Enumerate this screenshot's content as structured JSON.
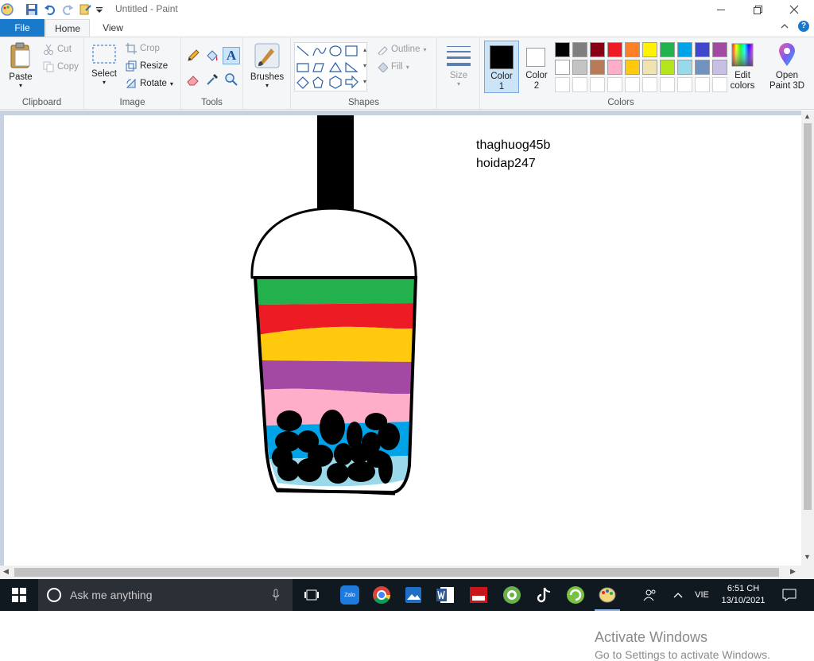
{
  "window": {
    "title": "Untitled - Paint"
  },
  "tabs": {
    "file": "File",
    "home": "Home",
    "view": "View"
  },
  "clipboard": {
    "paste": "Paste",
    "cut": "Cut",
    "copy": "Copy",
    "label": "Clipboard"
  },
  "image": {
    "select": "Select",
    "crop": "Crop",
    "resize": "Resize",
    "rotate": "Rotate",
    "label": "Image"
  },
  "tools": {
    "label": "Tools"
  },
  "brushes": {
    "label": "Brushes"
  },
  "shapes": {
    "outline": "Outline",
    "fill": "Fill",
    "label": "Shapes"
  },
  "size": {
    "label": "Size"
  },
  "colors": {
    "color1": "Color",
    "color1_num": "1",
    "color2": "Color",
    "color2_num": "2",
    "edit_line1": "Edit",
    "edit_line2": "colors",
    "paint3d_line1": "Open",
    "paint3d_line2": "Paint 3D",
    "label": "Colors",
    "current_color1": "#000000",
    "current_color2": "#ffffff",
    "palette_row1": [
      "#000000",
      "#7f7f7f",
      "#880015",
      "#ed1c24",
      "#ff7f27",
      "#fff200",
      "#22b14c",
      "#00a2e8",
      "#3f48cc",
      "#a349a4"
    ],
    "palette_row2": [
      "#ffffff",
      "#c3c3c3",
      "#b97a57",
      "#ffaec9",
      "#ffc90e",
      "#efe4b0",
      "#b5e61d",
      "#99d9ea",
      "#7092be",
      "#c8bfe7"
    ]
  },
  "canvas": {
    "text_line1": "thaghuog45b",
    "text_line2": "hoidap247",
    "layer_colors": [
      "#22b14c",
      "#ed1c24",
      "#ffc90e",
      "#a349a4",
      "#ffaec9",
      "#00a2e8",
      "#99d9ea"
    ]
  },
  "watermark": {
    "line1": "Activate Windows",
    "line2": "Go to Settings to activate Windows."
  },
  "taskbar": {
    "search_placeholder": "Ask me anything",
    "language": "VIE",
    "time": "6:51 CH",
    "date": "13/10/2021",
    "zalo": "Zalo"
  }
}
